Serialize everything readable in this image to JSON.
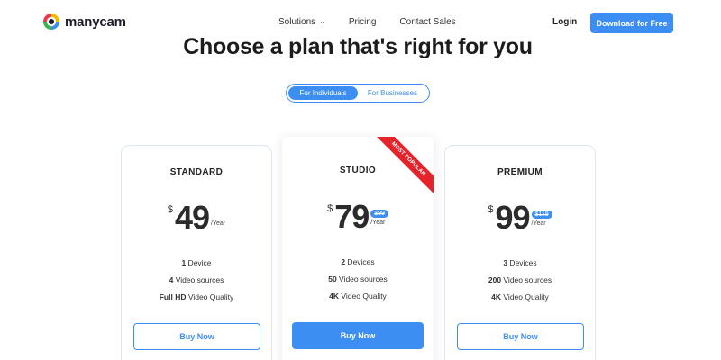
{
  "brand": {
    "name": "manycam",
    "accent": "#3d8ef3",
    "ribbon_color": "#e5232b"
  },
  "nav": {
    "items": [
      {
        "label": "Solutions",
        "has_dropdown": true
      },
      {
        "label": "Pricing"
      },
      {
        "label": "Contact Sales"
      }
    ],
    "login": "Login",
    "cta": "Download for Free"
  },
  "main": {
    "title": "Choose a plan that's right for you",
    "toggle": {
      "options": [
        "For Individuals",
        "For Businesses"
      ],
      "selected": "For Individuals"
    }
  },
  "plans": [
    {
      "name": "STANDARD",
      "currency": "$",
      "price": "49",
      "old_price": "",
      "period": "/Year",
      "features": [
        {
          "bold": "1",
          "text": " Device"
        },
        {
          "bold": "4",
          "text": " Video sources"
        },
        {
          "bold": "Full HD",
          "text": " Video Quality"
        }
      ],
      "button": "Buy Now",
      "highlighted": false
    },
    {
      "name": "STUDIO",
      "currency": "$",
      "price": "79",
      "old_price": "$99",
      "period": "/Year",
      "ribbon": "MOST POPULAR",
      "features": [
        {
          "bold": "2",
          "text": " Devices"
        },
        {
          "bold": "50",
          "text": " Video sources"
        },
        {
          "bold": "4K",
          "text": " Video Quality"
        }
      ],
      "button": "Buy Now",
      "highlighted": true
    },
    {
      "name": "PREMIUM",
      "currency": "$",
      "price": "99",
      "old_price": "$119",
      "period": "/Year",
      "features": [
        {
          "bold": "3",
          "text": " Devices"
        },
        {
          "bold": "200",
          "text": " Video sources"
        },
        {
          "bold": "4K",
          "text": " Video Quality"
        }
      ],
      "button": "Buy Now",
      "highlighted": false
    }
  ]
}
